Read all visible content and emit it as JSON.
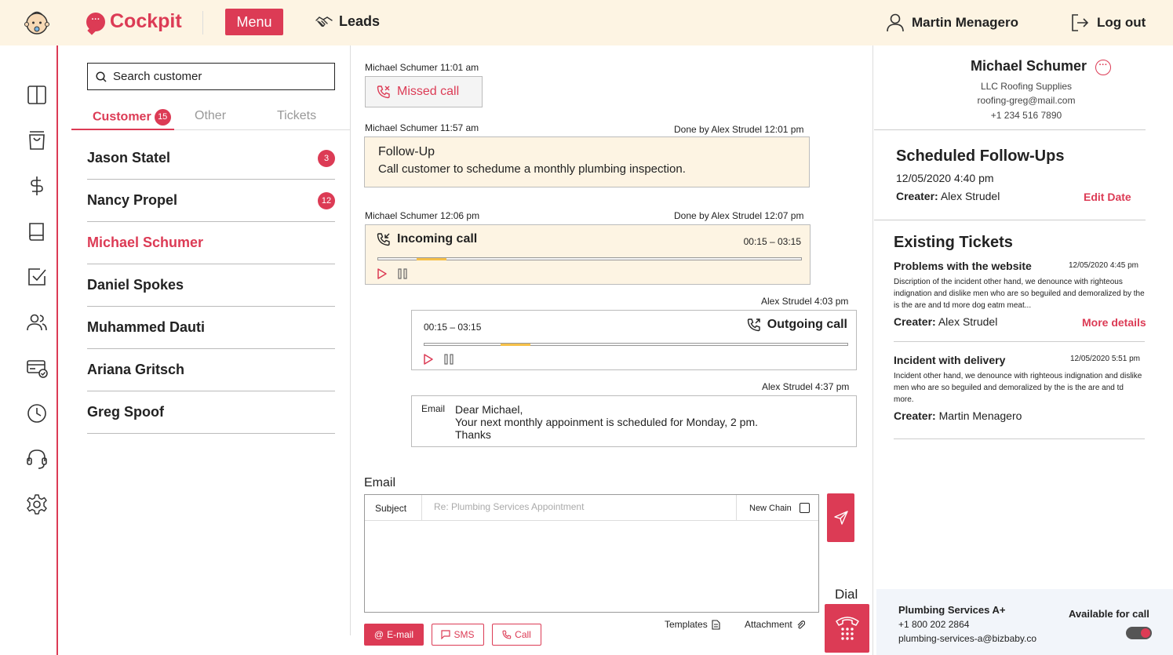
{
  "header": {
    "brand": "Cockpit",
    "menu_label": "Menu",
    "leads_label": "Leads",
    "user_name": "Martin Menagero",
    "logout_label": "Log out"
  },
  "sidebar": {
    "icons": [
      "layout-icon",
      "shopping-bag-icon",
      "dollar-icon",
      "book-icon",
      "checkbox-icon",
      "users-icon",
      "billing-icon",
      "clock-icon",
      "headset-icon",
      "settings-icon"
    ]
  },
  "customers": {
    "search_placeholder": "Search customer",
    "tabs": [
      {
        "label": "Customer",
        "count": "15"
      },
      {
        "label": "Other"
      },
      {
        "label": "Tickets"
      }
    ],
    "list": [
      {
        "name": "Jason Statel",
        "badge": "3"
      },
      {
        "name": "Nancy Propel",
        "badge": "12"
      },
      {
        "name": "Michael Schumer",
        "active": true
      },
      {
        "name": "Daniel Spokes"
      },
      {
        "name": "Muhammed Dauti"
      },
      {
        "name": "Ariana Gritsch"
      },
      {
        "name": "Greg Spoof"
      }
    ]
  },
  "timeline": {
    "missed": {
      "meta": "Michael Schumer  11:01 am",
      "label": "Missed call"
    },
    "followup": {
      "meta": "Michael Schumer  11:57 am",
      "done": "Done by Alex Strudel  12:01 pm",
      "title": "Follow-Up",
      "description": "Call customer to schedume a monthly plumbing inspection."
    },
    "incoming": {
      "meta": "Michael Schumer  12:06 pm",
      "done": "Done by Alex Strudel  12:07 pm",
      "title": "Incoming call",
      "time": "00:15 – 03:15",
      "progress_start": 0.09,
      "progress_end": 0.16
    },
    "outgoing": {
      "meta": "Alex Strudel  4:03 pm",
      "title": "Outgoing call",
      "time": "00:15 – 03:15",
      "progress_start": 0.18,
      "progress_end": 0.25
    },
    "email": {
      "meta": "Alex Strudel  4:37 pm",
      "tag": "Email",
      "line1": "Dear Michael,",
      "line2": "Your next monthly appoinment is scheduled for Monday, 2 pm.",
      "line3": "Thanks"
    }
  },
  "compose": {
    "label": "Email",
    "subject_label": "Subject",
    "subject_placeholder": "Re: Plumbing Services Appointment",
    "new_chain_label": "New Chain",
    "buttons": {
      "email": "E-mail",
      "sms": "SMS",
      "call": "Call"
    },
    "templates_label": "Templates",
    "attachment_label": "Attachment",
    "dial_label": "Dial"
  },
  "profile": {
    "name": "Michael Schumer",
    "company": "LLC Roofing Supplies",
    "email": "roofing-greg@mail.com",
    "phone": "+1 234 516 7890"
  },
  "followups": {
    "heading": "Scheduled Follow-Ups",
    "date": "12/05/2020 4:40 pm",
    "creator_label": "Creater:",
    "creator": "Alex Strudel",
    "edit_label": "Edit Date"
  },
  "tickets": {
    "heading": "Existing Tickets",
    "items": [
      {
        "title": "Problems with the website",
        "date": "12/05/2020 4:45 pm",
        "description": "Discription of the incident other hand, we denounce with righteous indignation and dislike men who are so beguiled and demoralized by the is the are and td more dog eatm meat...",
        "creator_label": "Creater:",
        "creator": "Alex Strudel",
        "link": "More details"
      },
      {
        "title": "Incident with delivery",
        "date": "12/05/2020 5:51 pm",
        "description": "Incident other hand, we denounce with righteous indignation and dislike men who are so beguiled and demoralized by the is the are and td more.",
        "creator_label": "Creater:",
        "creator": "Martin Menagero"
      }
    ]
  },
  "footer_card": {
    "company": "Plumbing Services A+",
    "phone": "+1 800 202 2864",
    "email": "plumbing-services-a@bizbaby.co",
    "availability_label": "Available for call",
    "available": true
  },
  "colors": {
    "accent": "#dc3b55",
    "header_bg": "#fdf4e3",
    "progress": "#f5c04a"
  }
}
